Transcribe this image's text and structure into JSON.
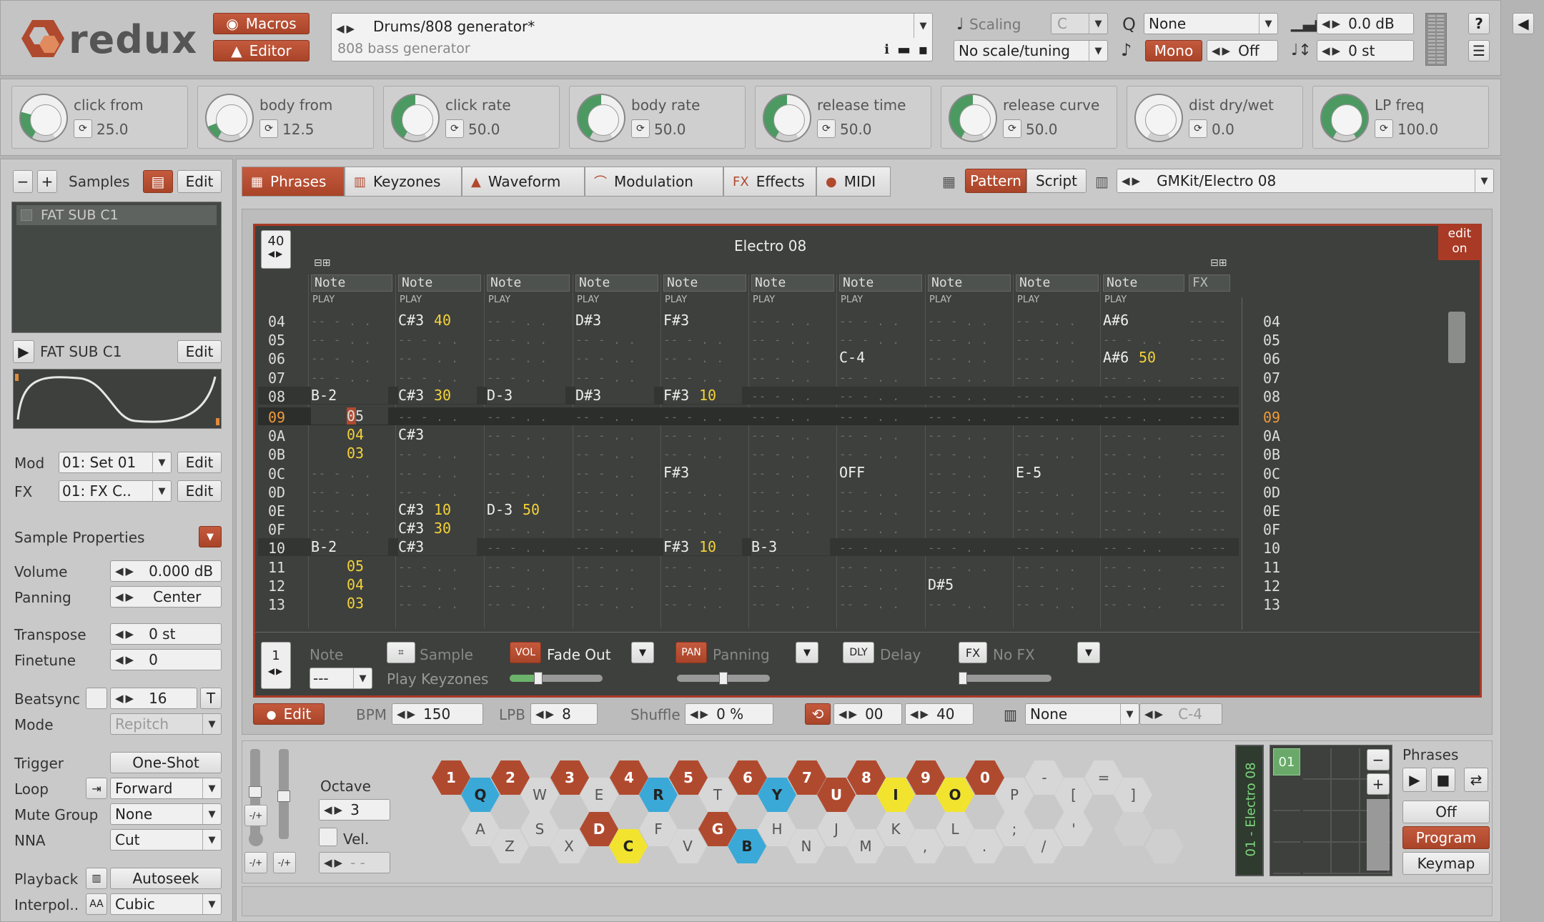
{
  "header": {
    "logo": "redux",
    "macros_label": "Macros",
    "editor_label": "Editor",
    "preset_path": "Drums/808 generator*",
    "preset_desc": "808 bass generator",
    "scaling_label": "Scaling",
    "scaling_key": "C",
    "scale_value": "No scale/tuning",
    "q_value": "None",
    "mono_label": "Mono",
    "glide_value": "Off",
    "volume_value": "0.0 dB",
    "transpose_value": "0 st",
    "help": "?"
  },
  "macros": [
    {
      "name": "click from",
      "value": "25.0",
      "level": 0.25
    },
    {
      "name": "body from",
      "value": "12.5",
      "level": 0.125
    },
    {
      "name": "click rate",
      "value": "50.0",
      "level": 0.5
    },
    {
      "name": "body rate",
      "value": "50.0",
      "level": 0.5
    },
    {
      "name": "release time",
      "value": "50.0",
      "level": 0.5
    },
    {
      "name": "release curve",
      "value": "50.0",
      "level": 0.5
    },
    {
      "name": "dist dry/wet",
      "value": "0.0",
      "level": 0.0
    },
    {
      "name": "LP freq",
      "value": "100.0",
      "level": 1.0
    }
  ],
  "left": {
    "minus": "−",
    "plus": "+",
    "samples_label": "Samples",
    "edit": "Edit",
    "sample_item": "FAT SUB C1",
    "sample_name": "FAT SUB C1",
    "mod_label": "Mod",
    "mod_value": "01: Set 01",
    "fx_label": "FX",
    "fx_value": "01: FX C..",
    "props_title": "Sample Properties",
    "props": [
      {
        "label": "Volume",
        "value": "0.000 dB"
      },
      {
        "label": "Panning",
        "value": "Center"
      },
      {
        "label": "Transpose",
        "value": "0 st"
      },
      {
        "label": "Finetune",
        "value": "0"
      },
      {
        "label": "Beatsync",
        "value": "16",
        "extra": "T"
      },
      {
        "label": "Mode",
        "value": "Repitch"
      },
      {
        "label": "Trigger",
        "value": "One-Shot"
      },
      {
        "label": "Loop",
        "value": "Forward"
      },
      {
        "label": "Mute Group",
        "value": "None"
      },
      {
        "label": "NNA",
        "value": "Cut"
      },
      {
        "label": "Playback",
        "value": "Autoseek"
      },
      {
        "label": "Interpol..",
        "value": "Cubic",
        "icon": "AA"
      }
    ]
  },
  "tabs": [
    {
      "label": "Phrases",
      "icon": "▦"
    },
    {
      "label": "Keyzones",
      "icon": "▥"
    },
    {
      "label": "Waveform",
      "icon": "▲"
    },
    {
      "label": "Modulation",
      "icon": "⌒"
    },
    {
      "label": "Effects",
      "icon": "FX"
    },
    {
      "label": "MIDI",
      "icon": "●"
    }
  ],
  "pattern_bar": {
    "pattern_label": "Pattern",
    "script_label": "Script",
    "kit": "GMKit/Electro 08"
  },
  "phrase": {
    "length": "40",
    "title": "Electro 08",
    "edit_on": "edit\non",
    "fx_header": "FX",
    "play_label": "PLAY",
    "note_header": "Note",
    "rows": [
      "04",
      "05",
      "06",
      "07",
      "08",
      "09",
      "0A",
      "0B",
      "0C",
      "0D",
      "0E",
      "0F",
      "10",
      "11",
      "12",
      "13"
    ],
    "current_row": "09",
    "cells": [
      {
        "r": 0,
        "c": 1,
        "t": "C#3",
        "v": "40"
      },
      {
        "r": 0,
        "c": 3,
        "t": "D#3",
        "v": ""
      },
      {
        "r": 0,
        "c": 4,
        "t": "F#3",
        "v": ""
      },
      {
        "r": 0,
        "c": 9,
        "t": "A#6",
        "v": ""
      },
      {
        "r": 2,
        "c": 6,
        "t": "C-4",
        "v": ""
      },
      {
        "r": 2,
        "c": 9,
        "t": "A#6",
        "v": "50"
      },
      {
        "r": 4,
        "c": 0,
        "t": "B-2",
        "v": ""
      },
      {
        "r": 4,
        "c": 1,
        "t": "C#3",
        "v": "30"
      },
      {
        "r": 4,
        "c": 2,
        "t": "D-3",
        "v": ""
      },
      {
        "r": 4,
        "c": 3,
        "t": "D#3",
        "v": ""
      },
      {
        "r": 4,
        "c": 4,
        "t": "F#3",
        "v": "10"
      },
      {
        "r": 5,
        "c": 0,
        "t": "",
        "v": "05"
      },
      {
        "r": 6,
        "c": 0,
        "t": "",
        "v": "04"
      },
      {
        "r": 6,
        "c": 1,
        "t": "C#3",
        "v": ""
      },
      {
        "r": 7,
        "c": 0,
        "t": "",
        "v": "03"
      },
      {
        "r": 8,
        "c": 4,
        "t": "F#3",
        "v": ""
      },
      {
        "r": 8,
        "c": 6,
        "t": "OFF",
        "v": ""
      },
      {
        "r": 8,
        "c": 8,
        "t": "E-5",
        "v": ""
      },
      {
        "r": 10,
        "c": 1,
        "t": "C#3",
        "v": "10"
      },
      {
        "r": 10,
        "c": 2,
        "t": "D-3",
        "v": "50"
      },
      {
        "r": 11,
        "c": 1,
        "t": "C#3",
        "v": "30"
      },
      {
        "r": 12,
        "c": 0,
        "t": "B-2",
        "v": ""
      },
      {
        "r": 12,
        "c": 1,
        "t": "C#3",
        "v": ""
      },
      {
        "r": 12,
        "c": 4,
        "t": "F#3",
        "v": "10"
      },
      {
        "r": 12,
        "c": 5,
        "t": "B-3",
        "v": ""
      },
      {
        "r": 13,
        "c": 0,
        "t": "",
        "v": "05"
      },
      {
        "r": 14,
        "c": 0,
        "t": "",
        "v": "04"
      },
      {
        "r": 14,
        "c": 7,
        "t": "D#5",
        "v": ""
      },
      {
        "r": 15,
        "c": 0,
        "t": "",
        "v": "03"
      }
    ],
    "step": "1",
    "note_label": "Note",
    "note_value": "---",
    "sample_label": "Sample",
    "play_keyzones": "Play Keyzones",
    "vol_tag": "VOL",
    "vol_value": "Fade Out",
    "pan_tag": "PAN",
    "pan_value": "Panning",
    "dly_tag": "DLY",
    "dly_value": "Delay",
    "fx_tag": "FX",
    "fx_value": "No FX"
  },
  "transport": {
    "edit": "Edit",
    "bpm_label": "BPM",
    "bpm": "150",
    "lpb_label": "LPB",
    "lpb": "8",
    "shuffle_label": "Shuffle",
    "shuffle": "0 %",
    "loop_start": "00",
    "loop_end": "40",
    "key_value": "None",
    "key_note": "C-4"
  },
  "keyboard": {
    "octave_label": "Octave",
    "octave": "3",
    "vel_label": "Vel.",
    "vel_value": "- -",
    "top": [
      "1",
      "2",
      "3",
      "4",
      "5",
      "6",
      "7",
      "8",
      "9",
      "0",
      "-",
      "="
    ],
    "upper": [
      "Q",
      "W",
      "E",
      "R",
      "T",
      "Y",
      "U",
      "I",
      "O",
      "P",
      "[",
      "]"
    ],
    "home": [
      "A",
      "S",
      "D",
      "F",
      "G",
      "H",
      "J",
      "K",
      "L",
      ";",
      "'"
    ],
    "bottom": [
      "Z",
      "X",
      "C",
      "V",
      "B",
      "N",
      "M",
      ",",
      ".",
      "/"
    ]
  },
  "phrases_panel": {
    "title": "Phrases",
    "vertical_label": "01 - Electro 08",
    "slot": "01",
    "off": "Off",
    "program": "Program",
    "keymap": "Keymap"
  },
  "colors": {
    "accent": "#b04a2f",
    "yellow": "#f2e42e",
    "blue": "#3aa9d8"
  }
}
